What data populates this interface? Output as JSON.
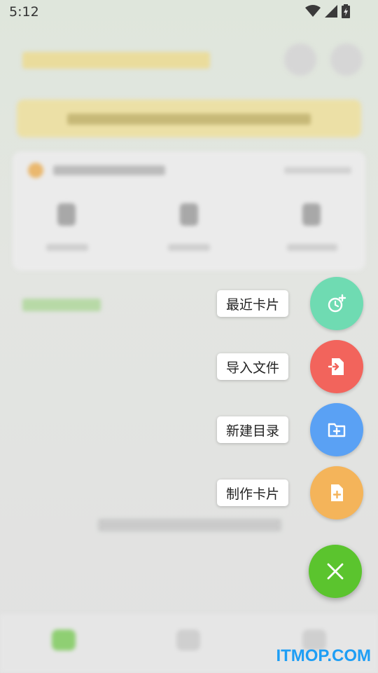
{
  "status_bar": {
    "time": "5:12"
  },
  "fab_menu": {
    "items": [
      {
        "label": "最近卡片",
        "icon": "recent-clock-icon",
        "color": "#6fdbb2"
      },
      {
        "label": "导入文件",
        "icon": "import-file-icon",
        "color": "#f2645c"
      },
      {
        "label": "新建目录",
        "icon": "new-folder-icon",
        "color": "#5aa1f4"
      },
      {
        "label": "制作卡片",
        "icon": "new-card-icon",
        "color": "#f4b45a"
      }
    ],
    "close_icon": "close-icon",
    "close_color": "#5bc42e"
  },
  "watermark": "ITMOP.COM"
}
